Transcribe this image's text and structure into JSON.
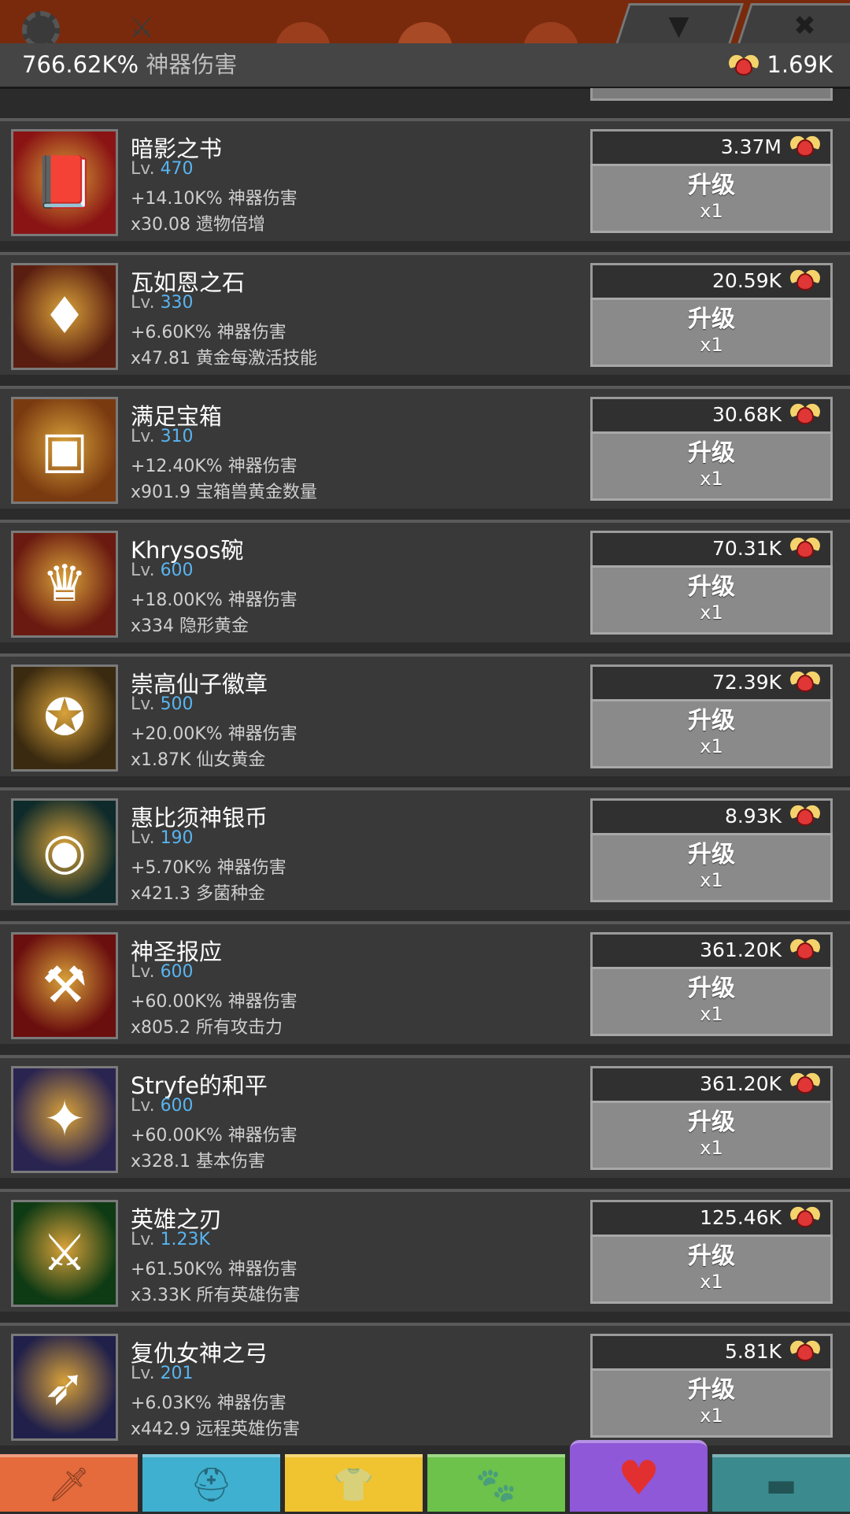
{
  "topbar": {
    "icons": [
      "gear-icon",
      "crossed-swords-icon",
      "timer-icon",
      "close-icon",
      "chevron-down-icon"
    ]
  },
  "header": {
    "total_value": "766.62K%",
    "total_label": "神器伤害",
    "relics": "1.69K"
  },
  "upgrade_label": "升级",
  "multiplier_label": "x1",
  "artifacts": [
    {
      "name": "暗影之书",
      "lvl_prefix": "Lv.",
      "level": "470",
      "effect1": "+14.10K% 神器伤害",
      "effect2": "x30.08 遗物倍增",
      "cost": "3.37M",
      "icon": "book-icon",
      "color": "#8a1414"
    },
    {
      "name": "瓦如恩之石",
      "lvl_prefix": "Lv.",
      "level": "330",
      "effect1": "+6.60K% 神器伤害",
      "effect2": "x47.81 黄金每激活技能",
      "cost": "20.59K",
      "icon": "gem-pendant-icon",
      "color": "#5a1e10"
    },
    {
      "name": "满足宝箱",
      "lvl_prefix": "Lv.",
      "level": "310",
      "effect1": "+12.40K% 神器伤害",
      "effect2": "x901.9 宝箱兽黄金数量",
      "cost": "30.68K",
      "icon": "treasure-chest-icon",
      "color": "#7a3a10"
    },
    {
      "name": "Khrysos碗",
      "lvl_prefix": "Lv.",
      "level": "600",
      "effect1": "+18.00K% 神器伤害",
      "effect2": "x334 隐形黄金",
      "cost": "70.31K",
      "icon": "gold-bowl-icon",
      "color": "#6a1a10"
    },
    {
      "name": "崇高仙子徽章",
      "lvl_prefix": "Lv.",
      "level": "500",
      "effect1": "+20.00K% 神器伤害",
      "effect2": "x1.87K 仙女黄金",
      "cost": "72.39K",
      "icon": "fairy-badge-icon",
      "color": "#3a2a10"
    },
    {
      "name": "惠比须神银币",
      "lvl_prefix": "Lv.",
      "level": "190",
      "effect1": "+5.70K% 神器伤害",
      "effect2": "x421.3 多菌种金",
      "cost": "8.93K",
      "icon": "coins-icon",
      "color": "#0e2a2a"
    },
    {
      "name": "神圣报应",
      "lvl_prefix": "Lv.",
      "level": "600",
      "effect1": "+60.00K% 神器伤害",
      "effect2": "x805.2 所有攻击力",
      "cost": "361.20K",
      "icon": "flame-axe-icon",
      "color": "#6a0e0e"
    },
    {
      "name": "Stryfe的和平",
      "lvl_prefix": "Lv.",
      "level": "600",
      "effect1": "+60.00K% 神器伤害",
      "effect2": "x328.1 基本伤害",
      "cost": "361.20K",
      "icon": "winged-flail-icon",
      "color": "#2a2450"
    },
    {
      "name": "英雄之刃",
      "lvl_prefix": "Lv.",
      "level": "1.23K",
      "effect1": "+61.50K% 神器伤害",
      "effect2": "x3.33K 所有英雄伤害",
      "cost": "125.46K",
      "icon": "green-blade-icon",
      "color": "#0e3a14"
    },
    {
      "name": "复仇女神之弓",
      "lvl_prefix": "Lv.",
      "level": "201",
      "effect1": "+6.03K% 神器伤害",
      "effect2": "x442.9 远程英雄伤害",
      "cost": "5.81K",
      "icon": "bow-icon",
      "color": "#20204a"
    }
  ],
  "bottom_tabs": [
    {
      "icon": "sword-icon",
      "color": "#e56a3c"
    },
    {
      "icon": "hero-helmet-icon",
      "color": "#3fb0cf"
    },
    {
      "icon": "armor-icon",
      "color": "#f0c330"
    },
    {
      "icon": "pet-icon",
      "color": "#6cc24a"
    },
    {
      "icon": "relic-heart-icon",
      "color": "#8e58d8",
      "selected": true
    },
    {
      "icon": "shop-chest-icon",
      "color": "#3a8a8e"
    }
  ]
}
